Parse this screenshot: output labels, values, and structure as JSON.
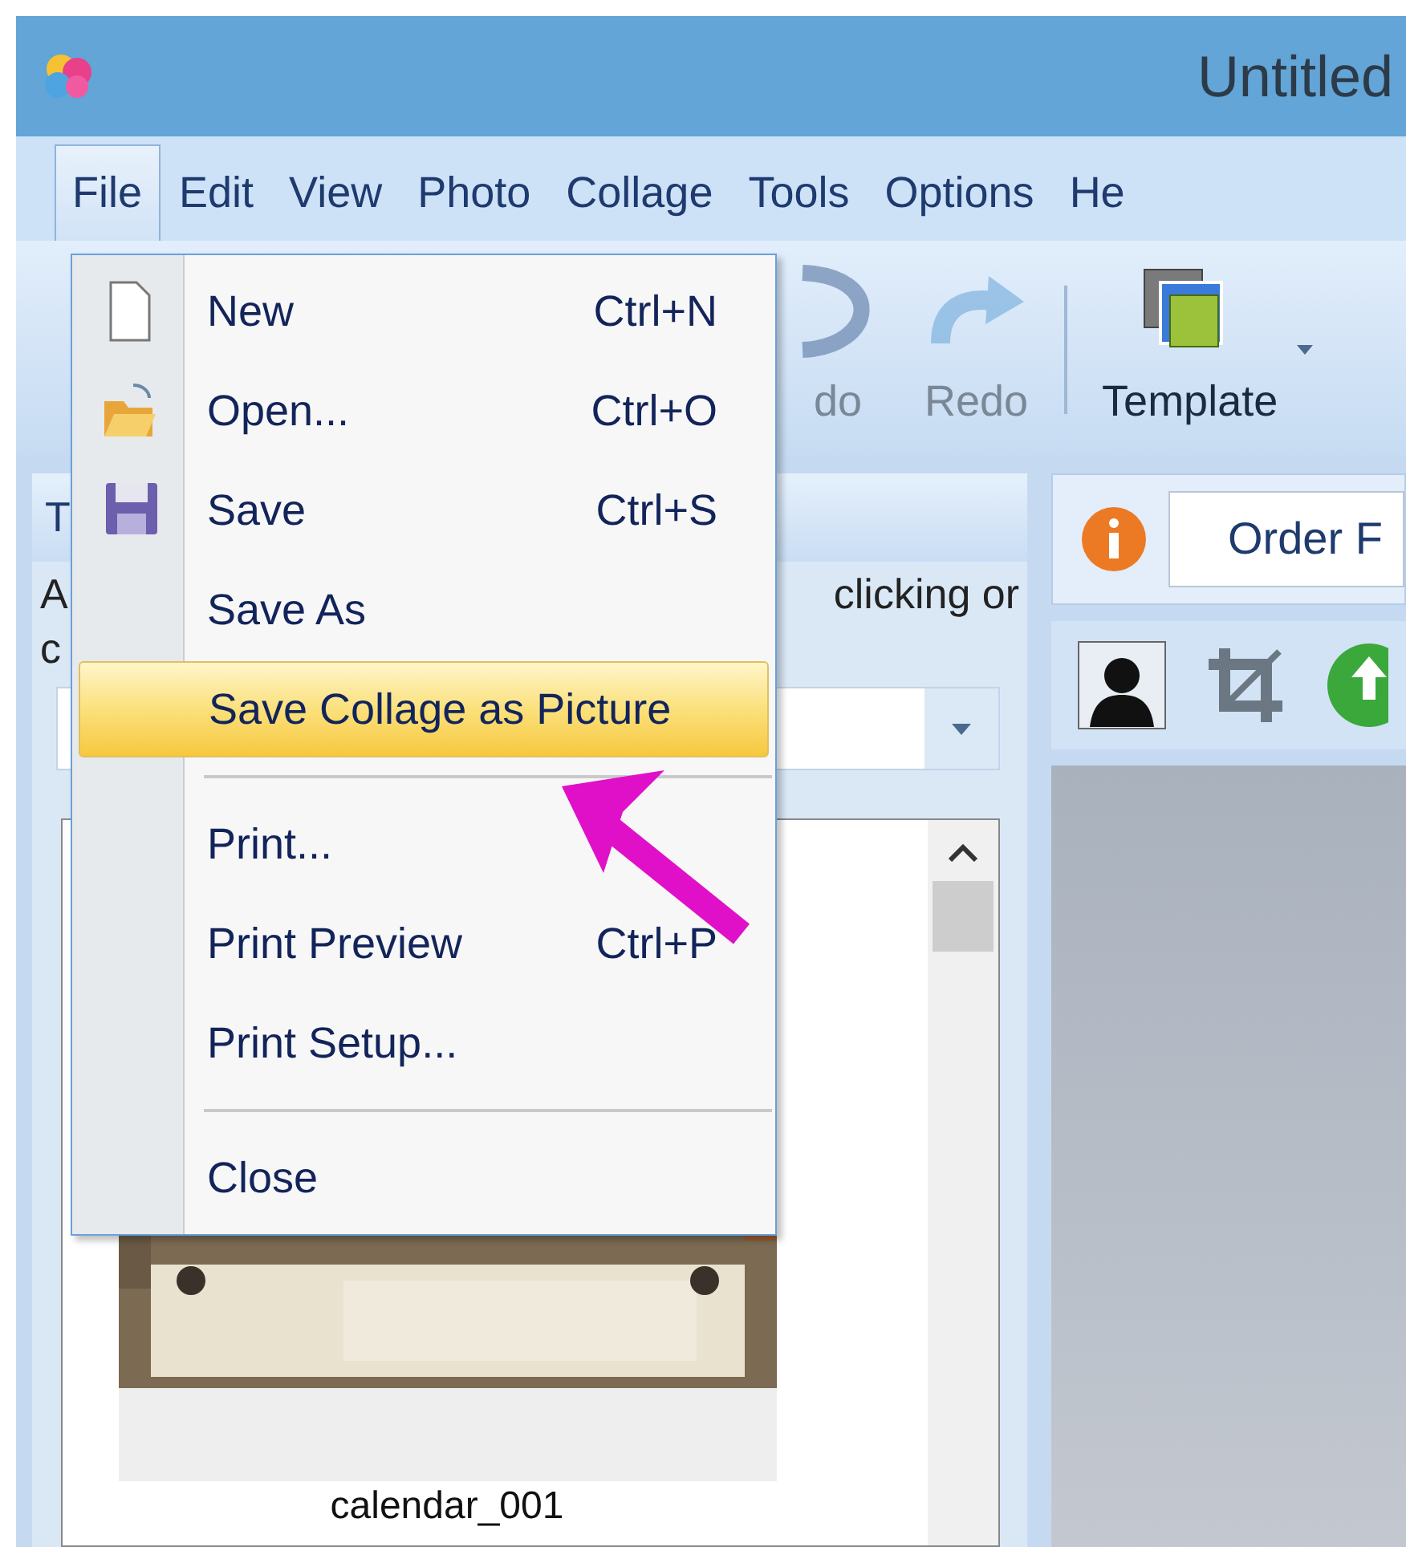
{
  "window": {
    "title": "Untitled"
  },
  "menu_bar": [
    {
      "label": "File",
      "selected": true
    },
    {
      "label": "Edit",
      "selected": false
    },
    {
      "label": "View",
      "selected": false
    },
    {
      "label": "Photo",
      "selected": false
    },
    {
      "label": "Collage",
      "selected": false
    },
    {
      "label": "Tools",
      "selected": false
    },
    {
      "label": "Options",
      "selected": false
    },
    {
      "label": "He",
      "selected": false
    }
  ],
  "toolbar": [
    {
      "kind": "undo",
      "label": "do",
      "disabled": true
    },
    {
      "kind": "redo",
      "label": "Redo",
      "disabled": true
    },
    {
      "kind": "template",
      "label": "Template",
      "disabled": false
    }
  ],
  "left_panel": {
    "title": "T",
    "line_1_start": "A",
    "line_1_end": "clicking or",
    "line_2_start": "c",
    "thumbnail_caption": "calendar_001"
  },
  "right_panel": {
    "order_field": "Order F"
  },
  "file_menu": [
    {
      "kind": "item",
      "label": "New",
      "shortcut": "Ctrl+N",
      "selected": false
    },
    {
      "kind": "item",
      "label": "Open...",
      "shortcut": "Ctrl+O",
      "selected": false
    },
    {
      "kind": "item",
      "label": "Save",
      "shortcut": "Ctrl+S",
      "selected": false
    },
    {
      "kind": "item",
      "label": "Save As",
      "selected": false
    },
    {
      "kind": "item",
      "label": "Save Collage as Picture",
      "selected": true
    },
    {
      "kind": "separator"
    },
    {
      "kind": "item",
      "label": "Print...",
      "selected": false
    },
    {
      "kind": "item",
      "label": "Print Preview",
      "shortcut": "Ctrl+P",
      "selected": false
    },
    {
      "kind": "item",
      "label": "Print Setup...",
      "selected": false
    },
    {
      "kind": "separator"
    },
    {
      "kind": "item",
      "label": "Close",
      "selected": false
    }
  ]
}
